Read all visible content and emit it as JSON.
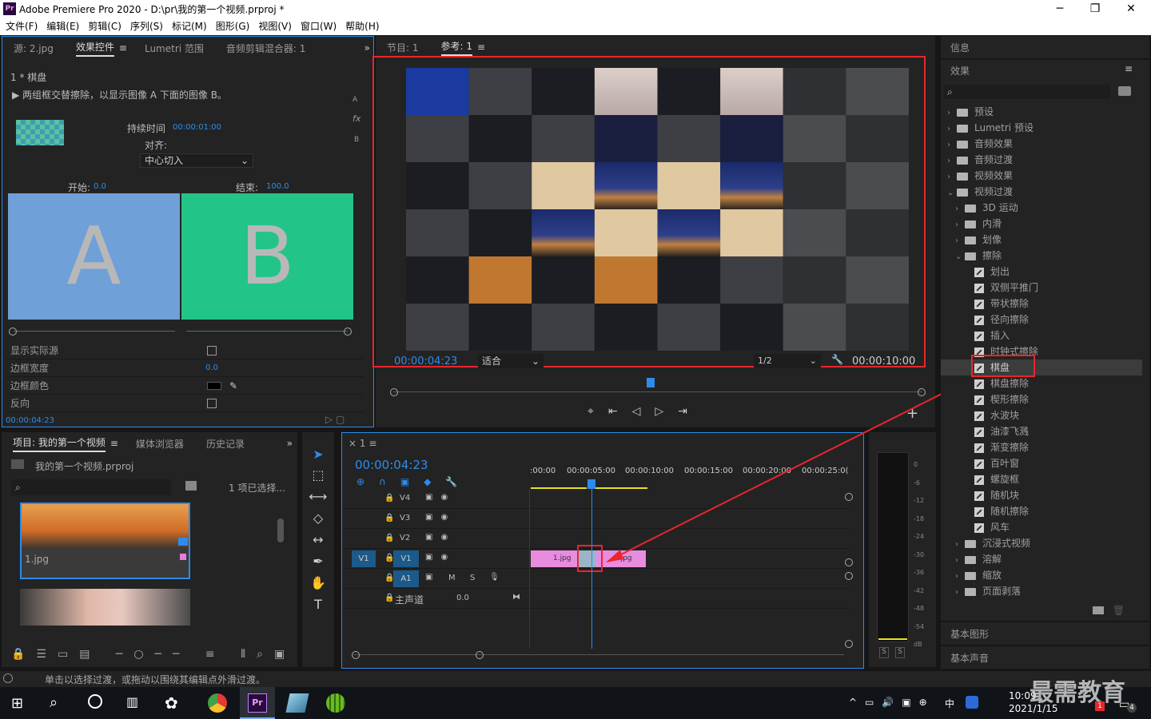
{
  "window": {
    "title": "Adobe Premiere Pro 2020 - D:\\pr\\我的第一个视频.prproj *",
    "logo": "Pr",
    "minimize": "─",
    "maximize": "❐",
    "close": "✕"
  },
  "menu": [
    "文件(F)",
    "编辑(E)",
    "剪辑(C)",
    "序列(S)",
    "标记(M)",
    "图形(G)",
    "视图(V)",
    "窗口(W)",
    "帮助(H)"
  ],
  "effect_controls": {
    "tabs": [
      "源: 2.jpg",
      "效果控件",
      "Lumetri 范围",
      "音频剪辑混合器: 1"
    ],
    "active_tab": "效果控件",
    "clip_label": "1 * 棋盘",
    "description": "两组框交替擦除，以显示图像 A 下面的图像 B。",
    "side_a": "A",
    "side_b": "B",
    "side_fx": "fx",
    "duration_label": "持续时间",
    "duration_value": "00:00:01:00",
    "align_label": "对齐:",
    "align_value": "中心切入",
    "start_label": "开始:",
    "start_value": "0.0",
    "end_label": "结束:",
    "end_value": "100.0",
    "letter_a": "A",
    "letter_b": "B",
    "color_a": "#6fa0d8",
    "color_b": "#22c487",
    "properties": [
      {
        "label": "显示实际源",
        "kind": "checkbox"
      },
      {
        "label": "边框宽度",
        "kind": "value",
        "value": "0.0"
      },
      {
        "label": "边框颜色",
        "kind": "color"
      },
      {
        "label": "反向",
        "kind": "checkbox"
      }
    ],
    "footer_time": "00:00:04:23"
  },
  "monitor": {
    "tabs": [
      "节目: 1",
      "参考: 1"
    ],
    "active_tab": "参考: 1",
    "timecode": "00:00:04:23",
    "fit_label": "适合",
    "resolution": "1/2",
    "duration": "00:00:10:00"
  },
  "project": {
    "tabs": [
      "项目: 我的第一个视频",
      "媒体浏览器",
      "历史记录"
    ],
    "file": "我的第一个视频.prproj",
    "selected": "1 项已选择...",
    "items": [
      "1.jpg"
    ]
  },
  "timeline": {
    "tab": "1",
    "timecode": "00:00:04:23",
    "ruler": [
      ":00:00",
      "00:00:05:00",
      "00:00:10:00",
      "00:00:15:00",
      "00:00:20:00",
      "00:00:25:0("
    ],
    "tracks": [
      "V4",
      "V3",
      "V2",
      "V1",
      "A1"
    ],
    "v1_source": "V1",
    "audio_m": "M",
    "audio_s": "S",
    "master_label": "主声道",
    "master_value": "0.0",
    "clips": [
      "1.jpg",
      "2.jpg"
    ]
  },
  "meter": {
    "scale": [
      "0",
      "-6",
      "-12",
      "-18",
      "-24",
      "-30",
      "-36",
      "-42",
      "-48",
      "-54",
      "dB"
    ],
    "solo": [
      "S",
      "S"
    ]
  },
  "effects_panel": {
    "info_title": "信息",
    "title": "效果",
    "folders_top": [
      "预设",
      "Lumetri 预设",
      "音频效果",
      "音频过渡",
      "视频效果",
      "视频过渡"
    ],
    "sub_folders": [
      "3D 运动",
      "内滑",
      "划像",
      "擦除"
    ],
    "wipe_items": [
      "划出",
      "双侧平推门",
      "带状擦除",
      "径向擦除",
      "插入",
      "时钟式擦除",
      "棋盘",
      "棋盘擦除",
      "楔形擦除",
      "水波块",
      "油漆飞溅",
      "渐变擦除",
      "百叶窗",
      "螺旋框",
      "随机块",
      "随机擦除",
      "风车"
    ],
    "selected_item": "棋盘",
    "folders_bottom": [
      "沉浸式视频",
      "溶解",
      "缩放",
      "页面剥落"
    ],
    "basic_graphics": "基本图形",
    "basic_audio": "基本声音"
  },
  "status": "单击以选择过渡，或拖动以围绕其编辑点外滑过渡。",
  "taskbar": {
    "time": "10:09",
    "date": "2021/1/15",
    "ime": "中",
    "watermark": "最需教育",
    "badge_1": "1",
    "badge_2": "4"
  },
  "accent": "#2d8ceb",
  "highlight": "#e8262b"
}
